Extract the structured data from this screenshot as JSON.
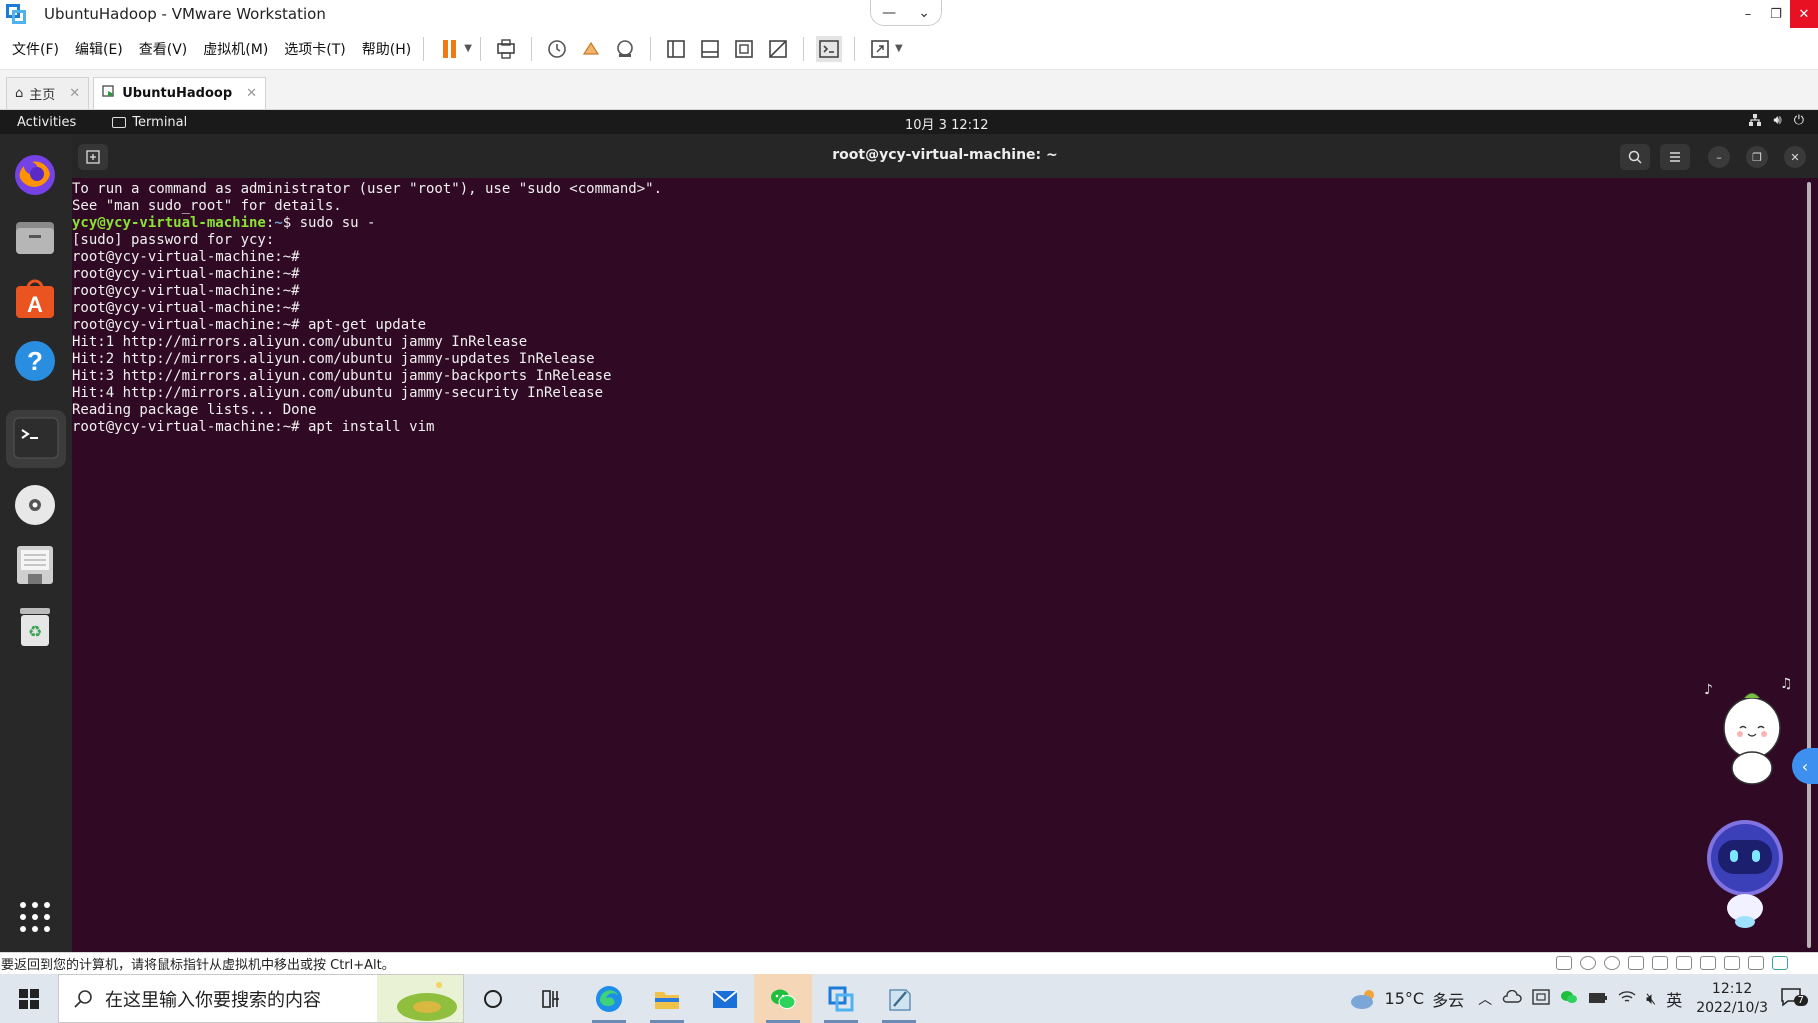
{
  "vmware": {
    "title": "UbuntuHadoop - VMware Workstation",
    "menu": [
      "文件(F)",
      "编辑(E)",
      "查看(V)",
      "虚拟机(M)",
      "选项卡(T)",
      "帮助(H)"
    ],
    "tabs": [
      {
        "label": "主页"
      },
      {
        "label": "UbuntuHadoop"
      }
    ],
    "status_text": "要返回到您的计算机，请将鼠标指针从虚拟机中移出或按 Ctrl+Alt。"
  },
  "ubuntu": {
    "activities": "Activities",
    "app_name": "Terminal",
    "clock": "10月 3  12:12"
  },
  "terminal": {
    "title": "root@ycy-virtual-machine: ~",
    "lines": [
      {
        "text": "To run a command as administrator (user \"root\"), use \"sudo <command>\"."
      },
      {
        "text": "See \"man sudo_root\" for details."
      },
      {
        "text": ""
      },
      {
        "user": "ycy@ycy-virtual-machine",
        "path": "~",
        "text": "$ sudo su -"
      },
      {
        "text": "[sudo] password for ycy:"
      },
      {
        "text": "root@ycy-virtual-machine:~#"
      },
      {
        "text": "root@ycy-virtual-machine:~#"
      },
      {
        "text": "root@ycy-virtual-machine:~#"
      },
      {
        "text": "root@ycy-virtual-machine:~#"
      },
      {
        "text": "root@ycy-virtual-machine:~# apt-get update"
      },
      {
        "text": "Hit:1 http://mirrors.aliyun.com/ubuntu jammy InRelease"
      },
      {
        "text": "Hit:2 http://mirrors.aliyun.com/ubuntu jammy-updates InRelease"
      },
      {
        "text": "Hit:3 http://mirrors.aliyun.com/ubuntu jammy-backports InRelease"
      },
      {
        "text": "Hit:4 http://mirrors.aliyun.com/ubuntu jammy-security InRelease"
      },
      {
        "text": "Reading package lists... Done"
      },
      {
        "text": "root@ycy-virtual-machine:~# apt install vim"
      }
    ]
  },
  "windows": {
    "search_placeholder": "在这里输入你要搜索的内容",
    "weather_temp": "15°C",
    "weather_desc": "多云",
    "ime": "英",
    "time": "12:12",
    "date": "2022/10/3",
    "notification_count": "7"
  },
  "colors": {
    "terminal_bg": "#300a24",
    "prompt_user": "#8ae234",
    "prompt_path": "#729fcf",
    "vm_close": "#e81123",
    "pause_orange": "#f07a14"
  },
  "icons": {
    "dock": [
      "firefox-icon",
      "files-icon",
      "app-center-icon",
      "help-icon",
      "terminal-icon",
      "disc-icon",
      "floppy-icon",
      "trash-icon",
      "show-apps-icon"
    ]
  }
}
